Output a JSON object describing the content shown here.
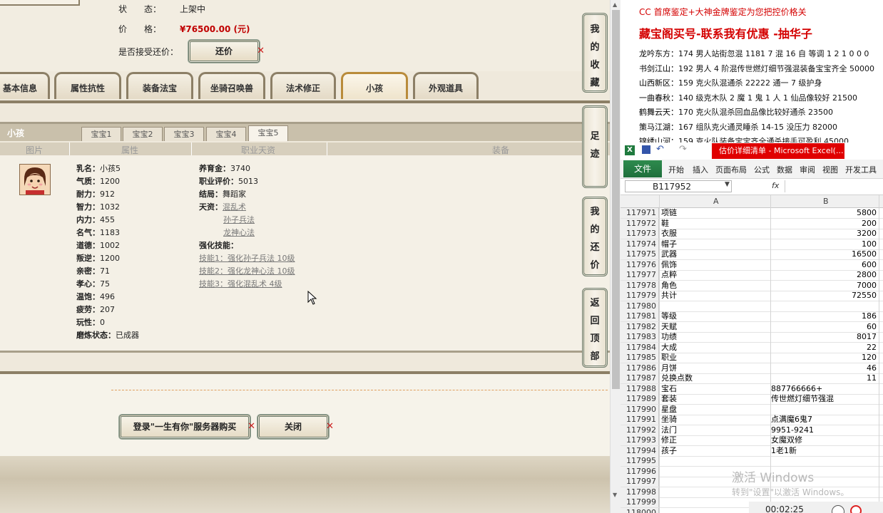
{
  "game": {
    "status_label": "状　　态：",
    "status_value": "上架中",
    "price_label": "价　　格：",
    "price_value": "¥76500.00 (元)",
    "counter_label": "是否接受还价：",
    "counter_button": "还价",
    "tabs": [
      "基本信息",
      "属性抗性",
      "装备法宝",
      "坐骑召唤兽",
      "法术修正",
      "小孩",
      "外观道具"
    ],
    "active_tab": "小孩",
    "section_title": "小孩",
    "subtabs": [
      "宝宝1",
      "宝宝2",
      "宝宝3",
      "宝宝4",
      "宝宝5"
    ],
    "active_subtab": "宝宝5",
    "columns": [
      "图片",
      "属性",
      "职业天资",
      "装备"
    ],
    "attributes": [
      {
        "k": "乳名：",
        "v": "小孩5"
      },
      {
        "k": "气质：",
        "v": "1200"
      },
      {
        "k": "耐力：",
        "v": "912"
      },
      {
        "k": "智力：",
        "v": "1032"
      },
      {
        "k": "内力：",
        "v": "455"
      },
      {
        "k": "名气：",
        "v": "1183"
      },
      {
        "k": "道德：",
        "v": "1002"
      },
      {
        "k": "叛逆：",
        "v": "1200"
      },
      {
        "k": "亲密：",
        "v": "71"
      },
      {
        "k": "孝心：",
        "v": "75"
      },
      {
        "k": "温饱：",
        "v": "496"
      },
      {
        "k": "疲劳：",
        "v": "207"
      },
      {
        "k": "玩性：",
        "v": "0"
      },
      {
        "k": "磨炼状态：",
        "v": "已成器"
      }
    ],
    "career": {
      "fund_label": "养育金：",
      "fund_value": "3740",
      "eval_label": "职业评价：",
      "eval_value": "5013",
      "ending_label": "结局：",
      "ending_value": "舞蹈家",
      "talent_label": "天资：",
      "talents": [
        "混乱术",
        "孙子兵法",
        "龙神心法"
      ],
      "skills_label": "强化技能：",
      "skills": [
        "技能1：强化孙子兵法 10级",
        "技能2：强化龙神心法 10级",
        "技能3：强化混乱术 4级"
      ]
    },
    "login_button": "登录\"一生有你\"服务器购买",
    "close_button": "关闭",
    "side_buttons": [
      "我的收藏",
      "足迹",
      "我的还价",
      "返回顶部"
    ]
  },
  "right": {
    "promo_small": "CC 首席鉴定+大神金牌鉴定为您把控价格关",
    "promo_big": "藏宝阁买号-联系我有优惠 -抽华子",
    "listings": [
      {
        "seller": "龙吟东方：",
        "text": "174 男人站街忽混 1181 7 混 16 自 等调 1 2 1 0 0 0"
      },
      {
        "seller": "书剑江山：",
        "text": "192 男人 4 阶混传世燃灯细节强混装备宝宝齐全 50000"
      },
      {
        "seller": "山西新区：",
        "text": "159 克火队混通杀 22222 通一 7 级护身"
      },
      {
        "seller": "一曲春秋：",
        "text": "140 级克木队 2 魔 1 鬼 1 人 1 仙品像较好 21500"
      },
      {
        "seller": "鹤舞云天：",
        "text": "170 克火队混杀回血品像比较好通杀 23500"
      },
      {
        "seller": "策马江湖：",
        "text": "167 组队克火通灵睡杀 14-15 没压力 82000"
      },
      {
        "seller": "锦绣山河：",
        "text": "159 克火队装备宝宝齐全通杀接手可盈利 45000"
      }
    ],
    "excel": {
      "title": "估价详细清单 - Microsoft Excel(...",
      "file_tab": "文件",
      "menu": [
        "开始",
        "插入",
        "页面布局",
        "公式",
        "数据",
        "审阅",
        "视图",
        "开发工具"
      ],
      "name_box": "B117952",
      "fx": "fx",
      "col_headers": [
        "A",
        "B"
      ],
      "rows": [
        {
          "n": "117971",
          "a": "项链",
          "b": "5800",
          "num": true
        },
        {
          "n": "117972",
          "a": "鞋",
          "b": "200",
          "num": true
        },
        {
          "n": "117973",
          "a": "衣服",
          "b": "3200",
          "num": true
        },
        {
          "n": "117974",
          "a": "帽子",
          "b": "100",
          "num": true
        },
        {
          "n": "117975",
          "a": "武器",
          "b": "16500",
          "num": true
        },
        {
          "n": "117976",
          "a": "佩饰",
          "b": "600",
          "num": true
        },
        {
          "n": "117977",
          "a": "点粹",
          "b": "2800",
          "num": true
        },
        {
          "n": "117978",
          "a": "角色",
          "b": "7000",
          "num": true
        },
        {
          "n": "117979",
          "a": "共计",
          "b": "72550",
          "num": true
        },
        {
          "n": "117980",
          "a": "",
          "b": "",
          "num": true
        },
        {
          "n": "117981",
          "a": "等级",
          "b": "186",
          "num": true
        },
        {
          "n": "117982",
          "a": "天赋",
          "b": "60",
          "num": true
        },
        {
          "n": "117983",
          "a": "功绩",
          "b": "8017",
          "num": true
        },
        {
          "n": "117984",
          "a": "大成",
          "b": "22",
          "num": true
        },
        {
          "n": "117985",
          "a": "职业",
          "b": "120",
          "num": true
        },
        {
          "n": "117986",
          "a": "月饼",
          "b": "46",
          "num": true
        },
        {
          "n": "117987",
          "a": "兑换点数",
          "b": "11",
          "num": true
        },
        {
          "n": "117988",
          "a": "宝石",
          "b": "887766666+",
          "num": false
        },
        {
          "n": "117989",
          "a": "套装",
          "b": "传世燃灯细节强混",
          "num": false
        },
        {
          "n": "117990",
          "a": "星盘",
          "b": "",
          "num": false
        },
        {
          "n": "117991",
          "a": "坐骑",
          "b": "点满魔6鬼7",
          "num": false
        },
        {
          "n": "117992",
          "a": "法门",
          "b": "9951-9241",
          "num": false
        },
        {
          "n": "117993",
          "a": "修正",
          "b": "女魔双修",
          "num": false
        },
        {
          "n": "117994",
          "a": "孩子",
          "b": "1老1新",
          "num": false
        },
        {
          "n": "117995",
          "a": "",
          "b": "",
          "num": false
        },
        {
          "n": "117996",
          "a": "",
          "b": "",
          "num": false
        },
        {
          "n": "117997",
          "a": "",
          "b": "",
          "num": false
        },
        {
          "n": "117998",
          "a": "",
          "b": "",
          "num": false
        },
        {
          "n": "117999",
          "a": "",
          "b": "",
          "num": false
        },
        {
          "n": "118000",
          "a": "",
          "b": "",
          "num": false
        }
      ],
      "watermark_title": "激活 Windows",
      "watermark_sub": "转到\"设置\"以激活 Windows。",
      "timer": "00:02:25"
    }
  }
}
